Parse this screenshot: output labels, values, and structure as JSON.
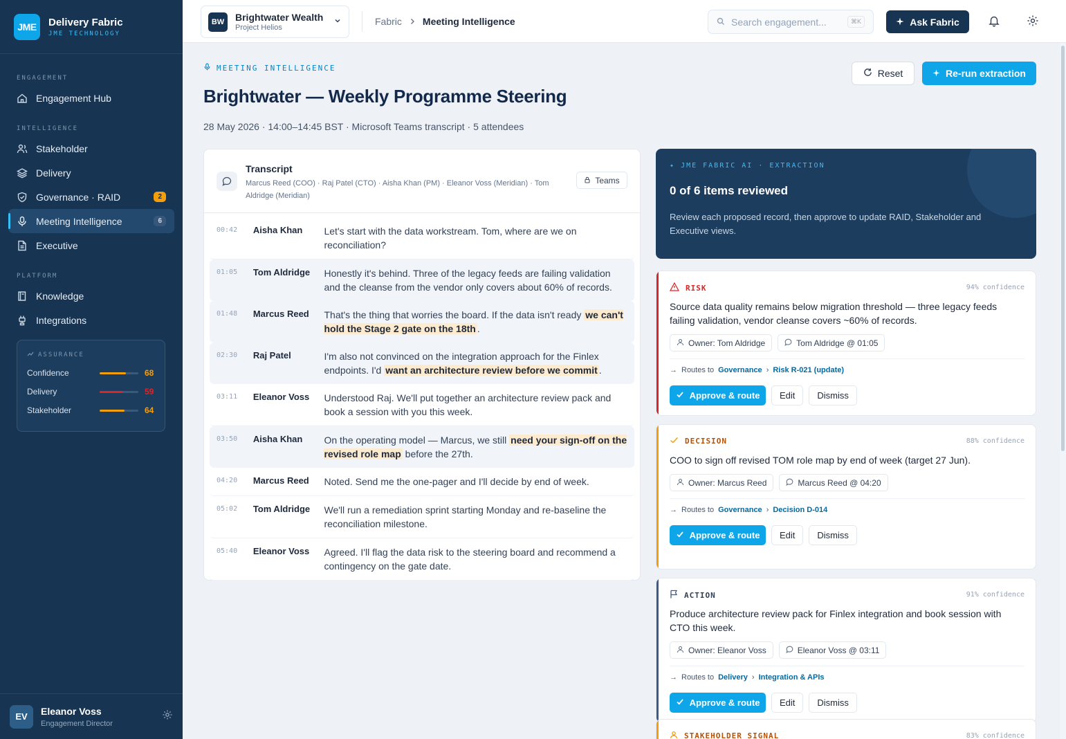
{
  "brand": {
    "name": "Delivery Fabric",
    "sub": "JME TECHNOLOGY",
    "logo": "JME"
  },
  "nav": {
    "sections": {
      "engagement": "ENGAGEMENT",
      "intelligence": "INTELLIGENCE",
      "platform": "PLATFORM"
    },
    "items": [
      {
        "label": "Engagement Hub",
        "icon": "home-icon"
      },
      {
        "label": "Stakeholder",
        "icon": "users-icon"
      },
      {
        "label": "Delivery",
        "icon": "layers-icon"
      },
      {
        "label": "Governance · RAID",
        "icon": "shield-icon",
        "badge": "2"
      },
      {
        "label": "Meeting Intelligence",
        "icon": "mic-icon",
        "badge": "6",
        "active": true
      },
      {
        "label": "Executive",
        "icon": "document-icon"
      },
      {
        "label": "Knowledge",
        "icon": "book-icon"
      },
      {
        "label": "Integrations",
        "icon": "plug-icon"
      }
    ]
  },
  "assurance": {
    "title": "ASSURANCE",
    "rows": [
      {
        "label": "Confidence",
        "value": "68",
        "level": 0.68,
        "color": "#f59e0b"
      },
      {
        "label": "Delivery",
        "value": "59",
        "level": 0.59,
        "color": "#dc2626"
      },
      {
        "label": "Stakeholder",
        "value": "64",
        "level": 0.64,
        "color": "#f59e0b"
      }
    ]
  },
  "user": {
    "initials": "EV",
    "name": "Eleanor Voss",
    "role": "Engagement Director"
  },
  "topbar": {
    "client_initials": "BW",
    "client_name": "Brightwater Wealth",
    "client_project": "Project Helios",
    "breadcrumb_root": "Fabric",
    "breadcrumb_current": "Meeting Intelligence",
    "search_placeholder": "Search engagement...",
    "search_shortcut": "⌘K",
    "ask_label": "Ask Fabric"
  },
  "page": {
    "eyebrow": "MEETING INTELLIGENCE",
    "title": "Brightwater — Weekly Programme Steering",
    "meta": "28 May 2026 · 14:00–14:45 BST · Microsoft Teams transcript · 5 attendees",
    "reset_label": "Reset",
    "rerun_label": "Re-run extraction"
  },
  "transcript": {
    "title": "Transcript",
    "participants": "Marcus Reed (COO) · Raj Patel (CTO) · Aisha Khan (PM) · Eleanor Voss (Meridian) · Tom Aldridge (Meridian)",
    "source": "Teams",
    "lines": [
      {
        "time": "00:42",
        "speaker": "Aisha Khan",
        "pre": "Let's start with the data workstream. Tom, where are we on reconciliation?",
        "mark": "",
        "post": "",
        "hl": false
      },
      {
        "time": "01:05",
        "speaker": "Tom Aldridge",
        "pre": "Honestly it's behind. Three of the legacy feeds are failing validation and the cleanse from the vendor only covers about 60% of records.",
        "mark": "",
        "post": "",
        "hl": true
      },
      {
        "time": "01:48",
        "speaker": "Marcus Reed",
        "pre": "That's the thing that worries the board. If the data isn't ready ",
        "mark": "we can't hold the Stage 2 gate on the 18th",
        "post": ".",
        "hl": true
      },
      {
        "time": "02:30",
        "speaker": "Raj Patel",
        "pre": "I'm also not convinced on the integration approach for the Finlex endpoints. I'd ",
        "mark": "want an architecture review before we commit",
        "post": ".",
        "hl": true
      },
      {
        "time": "03:11",
        "speaker": "Eleanor Voss",
        "pre": "Understood Raj. We'll put together an architecture review pack and book a session with you this week.",
        "mark": "",
        "post": "",
        "hl": false
      },
      {
        "time": "03:50",
        "speaker": "Aisha Khan",
        "pre": "On the operating model — Marcus, we still ",
        "mark": "need your sign-off on the revised role map",
        "post": " before the 27th.",
        "hl": true
      },
      {
        "time": "04:20",
        "speaker": "Marcus Reed",
        "pre": "Noted. Send me the one-pager and I'll decide by end of week.",
        "mark": "",
        "post": "",
        "hl": false
      },
      {
        "time": "05:02",
        "speaker": "Tom Aldridge",
        "pre": "We'll run a remediation sprint starting Monday and re-baseline the reconciliation milestone.",
        "mark": "",
        "post": "",
        "hl": false
      },
      {
        "time": "05:40",
        "speaker": "Eleanor Voss",
        "pre": "Agreed. I'll flag the data risk to the steering board and recommend a contingency on the gate date.",
        "mark": "",
        "post": "",
        "hl": false
      }
    ]
  },
  "extraction": {
    "eyebrow": "JME FABRIC AI · EXTRACTION",
    "title": "0 of 6 items reviewed",
    "desc": "Review each proposed record, then approve to update RAID, Stakeholder and Executive views."
  },
  "items": [
    {
      "type": "RISK",
      "color": "#dc2626",
      "icon": "warning-icon",
      "confidence": "94% confidence",
      "text": "Source data quality remains below migration threshold — three legacy feeds failing validation, vendor cleanse covers ~60% of records.",
      "owner": "Owner: Tom Aldridge",
      "source": "Tom Aldridge @ 01:05",
      "routes_label": "Routes to",
      "route_area": "Governance",
      "route_target": "Risk R-021 (update)",
      "approve": "Approve & route",
      "edit": "Edit",
      "dismiss": "Dismiss"
    },
    {
      "type": "DECISION",
      "color": "#f59e0b",
      "icon": "check-icon",
      "confidence": "88% confidence",
      "text": "COO to sign off revised TOM role map by end of week (target 27 Jun).",
      "owner": "Owner: Marcus Reed",
      "source": "Marcus Reed @ 04:20",
      "routes_label": "Routes to",
      "route_area": "Governance",
      "route_target": "Decision D-014",
      "approve": "Approve & route",
      "edit": "Edit",
      "dismiss": "Dismiss"
    },
    {
      "type": "ACTION",
      "color": "#3b5b85",
      "icon": "flag-icon",
      "confidence": "91% confidence",
      "text": "Produce architecture review pack for Finlex integration and book session with CTO this week.",
      "owner": "Owner: Eleanor Voss",
      "source": "Eleanor Voss @ 03:11",
      "routes_label": "Routes to",
      "route_area": "Delivery",
      "route_target": "Integration & APIs",
      "approve": "Approve & route",
      "edit": "Edit",
      "dismiss": "Dismiss"
    },
    {
      "type": "STAKEHOLDER SIGNAL",
      "color": "#f59e0b",
      "icon": "person-icon",
      "confidence": "83% confidence"
    }
  ]
}
